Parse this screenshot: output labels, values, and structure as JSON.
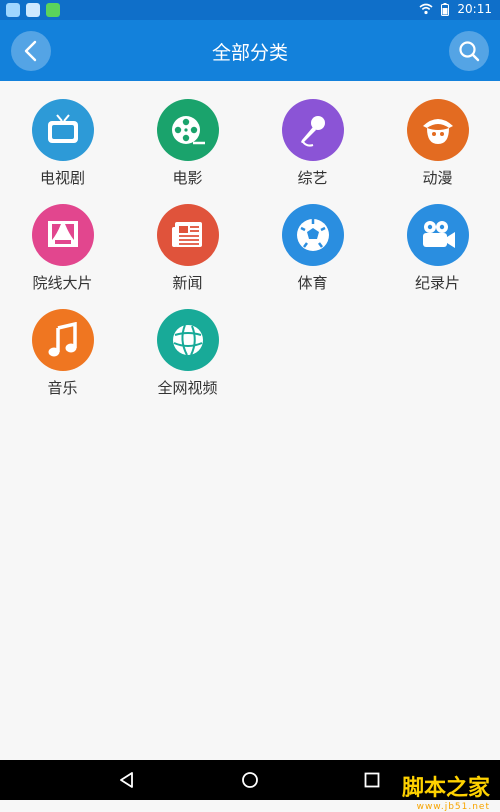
{
  "status": {
    "time": "20:11",
    "icons": [
      "image-notification-icon",
      "desktop-notification-icon",
      "wechat-icon",
      "wifi-icon",
      "battery-icon"
    ]
  },
  "header": {
    "title": "全部分类",
    "back_icon": "chevron-left-icon",
    "search_icon": "search-icon",
    "color": "#1381db"
  },
  "categories": [
    {
      "label": "电视剧",
      "icon": "tv-icon",
      "color": "#2d9ad7"
    },
    {
      "label": "电影",
      "icon": "film-reel-icon",
      "color": "#1aa36c"
    },
    {
      "label": "综艺",
      "icon": "microphone-icon",
      "color": "#8b54d6"
    },
    {
      "label": "动漫",
      "icon": "anime-icon",
      "color": "#e36b21"
    },
    {
      "label": "院线大片",
      "icon": "theater-icon",
      "color": "#e2468e"
    },
    {
      "label": "新闻",
      "icon": "newspaper-icon",
      "color": "#e0533b"
    },
    {
      "label": "体育",
      "icon": "soccer-ball-icon",
      "color": "#2a8ee0"
    },
    {
      "label": "纪录片",
      "icon": "video-camera-icon",
      "color": "#2a8ee0"
    },
    {
      "label": "音乐",
      "icon": "music-note-icon",
      "color": "#ef7621"
    },
    {
      "label": "全网视频",
      "icon": "globe-icon",
      "color": "#18aa98"
    }
  ],
  "navbar": {
    "buttons": [
      "back-triangle-icon",
      "home-circle-icon",
      "recents-square-icon"
    ]
  },
  "watermark": {
    "text": "脚本之家",
    "url": "www.jb51.net"
  }
}
